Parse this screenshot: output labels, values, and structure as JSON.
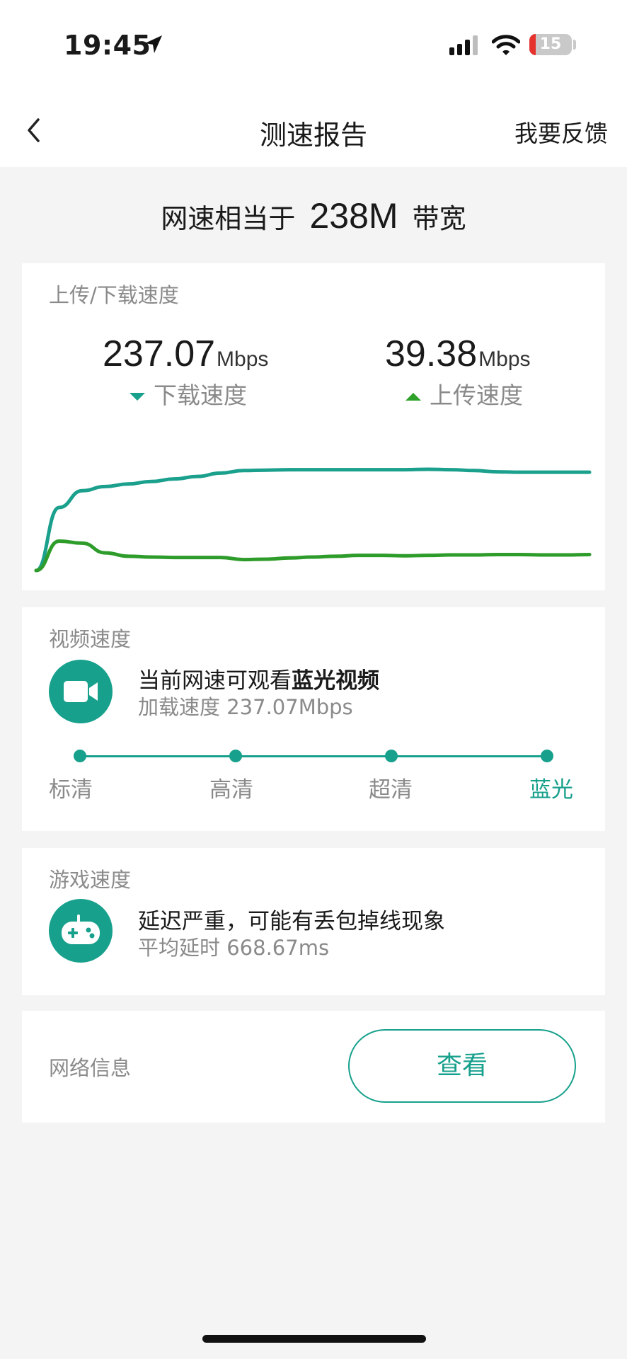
{
  "status_bar": {
    "time": "19:45",
    "battery_level": "15",
    "battery_fraction": 0.15
  },
  "nav": {
    "title": "测速报告",
    "feedback_label": "我要反馈"
  },
  "headline": {
    "prefix": "网速相当于",
    "value": "238M",
    "suffix": "带宽"
  },
  "speed_card": {
    "title": "上传/下载速度",
    "download": {
      "value": "237.07",
      "unit": "Mbps",
      "label": "下载速度"
    },
    "upload": {
      "value": "39.38",
      "unit": "Mbps",
      "label": "上传速度"
    }
  },
  "chart_data": {
    "type": "line",
    "title": "",
    "xlabel": "",
    "ylabel": "",
    "ylim": [
      0,
      300
    ],
    "grid": false,
    "legend": "none",
    "x": [
      0,
      1,
      2,
      3,
      4,
      5,
      6,
      7,
      8,
      9,
      10,
      11,
      12,
      13,
      14,
      15,
      16,
      17,
      18,
      19,
      20,
      21,
      22,
      23,
      24
    ],
    "series": [
      {
        "color": "#1aa08c",
        "values": [
          0,
          150,
          190,
          200,
          206,
          212,
          218,
          224,
          232,
          238,
          239,
          240,
          240,
          240,
          240,
          240,
          240,
          241,
          240,
          238,
          235,
          234,
          234,
          234,
          234
        ]
      },
      {
        "color": "#2e9c2a",
        "values": [
          0,
          70,
          65,
          42,
          34,
          32,
          31,
          31,
          31,
          26,
          27,
          30,
          32,
          34,
          36,
          36,
          35,
          36,
          37,
          37,
          38,
          38,
          37,
          37,
          38
        ]
      }
    ]
  },
  "video_card": {
    "title": "视频速度",
    "icon": "video-camera-icon",
    "main_prefix": "当前网速可观看",
    "main_bold": "蓝光视频",
    "sub": "加载速度 237.07Mbps",
    "levels": [
      "标清",
      "高清",
      "超清",
      "蓝光"
    ],
    "active_level": "蓝光"
  },
  "game_card": {
    "title": "游戏速度",
    "icon": "gamepad-icon",
    "main": "延迟严重，可能有丢包掉线现象",
    "sub": "平均延时 668.67ms"
  },
  "network_card": {
    "label": "网络信息",
    "button_label": "查看"
  },
  "colors": {
    "accent": "#17a08c",
    "upload_green": "#2ea12a",
    "battery_red": "#e5322d"
  }
}
